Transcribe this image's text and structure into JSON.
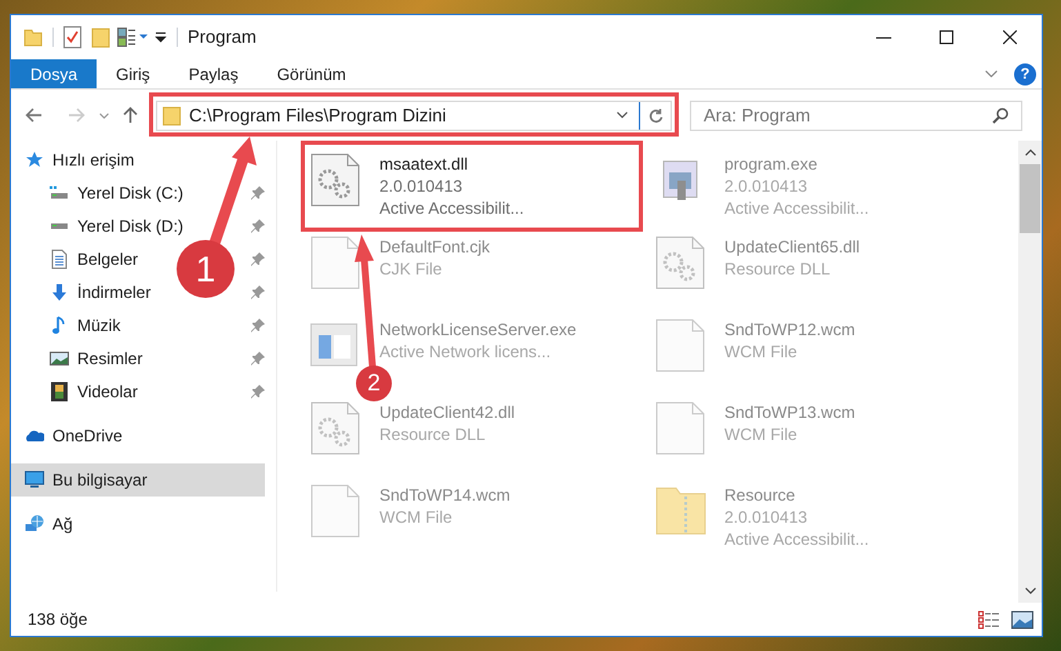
{
  "window": {
    "title": "Program"
  },
  "ribbon_tabs": [
    {
      "label": "Dosya",
      "selected": true
    },
    {
      "label": "Giriş",
      "selected": false
    },
    {
      "label": "Paylaş",
      "selected": false
    },
    {
      "label": "Görünüm",
      "selected": false
    }
  ],
  "help_button": "?",
  "address_bar": {
    "path": "C:\\Program Files\\Program Dizini"
  },
  "search": {
    "placeholder": "Ara: Program"
  },
  "sidebar": {
    "items": [
      {
        "label": "Hızlı erişim",
        "selected": false,
        "children": [
          {
            "label": "Yerel Disk (C:)",
            "pinned": true,
            "selected": false
          },
          {
            "label": "Yerel Disk (D:)",
            "pinned": true,
            "selected": false
          },
          {
            "label": "Belgeler",
            "pinned": true,
            "selected": false
          },
          {
            "label": "İndirmeler",
            "pinned": true,
            "selected": false
          },
          {
            "label": "Müzik",
            "pinned": true,
            "selected": false
          },
          {
            "label": "Resimler",
            "pinned": true,
            "selected": false
          },
          {
            "label": "Videolar",
            "pinned": true,
            "selected": false
          }
        ]
      },
      {
        "label": "OneDrive",
        "selected": false
      },
      {
        "label": "Bu bilgisayar",
        "selected": true
      },
      {
        "label": "Ağ",
        "selected": false
      }
    ]
  },
  "files": [
    {
      "name": "msaatext.dll",
      "details": [
        "2.0.010413",
        "Active Accessibilit..."
      ],
      "kind": "dll",
      "blurred": false
    },
    {
      "name": "program.exe",
      "details": [
        "2.0.010413",
        "Active Accessibilit..."
      ],
      "kind": "exe",
      "blurred": true
    },
    {
      "name": "DefaultFont.cjk",
      "details": [
        "CJK File"
      ],
      "kind": "file",
      "blurred": true
    },
    {
      "name": "UpdateClient65.dll",
      "details": [
        "Resource DLL"
      ],
      "kind": "dll",
      "blurred": true
    },
    {
      "name": "NetworkLicenseServer.exe",
      "details": [
        "Active Network licens..."
      ],
      "kind": "app",
      "blurred": true
    },
    {
      "name": "SndToWP12.wcm",
      "details": [
        "WCM File"
      ],
      "kind": "file",
      "blurred": true
    },
    {
      "name": "UpdateClient42.dll",
      "details": [
        "Resource DLL"
      ],
      "kind": "dll",
      "blurred": true
    },
    {
      "name": "SndToWP13.wcm",
      "details": [
        "WCM File"
      ],
      "kind": "file",
      "blurred": true
    },
    {
      "name": "SndToWP14.wcm",
      "details": [
        "WCM File"
      ],
      "kind": "file",
      "blurred": true
    },
    {
      "name": "Resource",
      "details": [
        "2.0.010413",
        "Active Accessibilit..."
      ],
      "kind": "folder",
      "blurred": true
    }
  ],
  "status_bar": {
    "count": "138 öğe"
  },
  "annotations": [
    {
      "label": "1"
    },
    {
      "label": "2"
    }
  ]
}
